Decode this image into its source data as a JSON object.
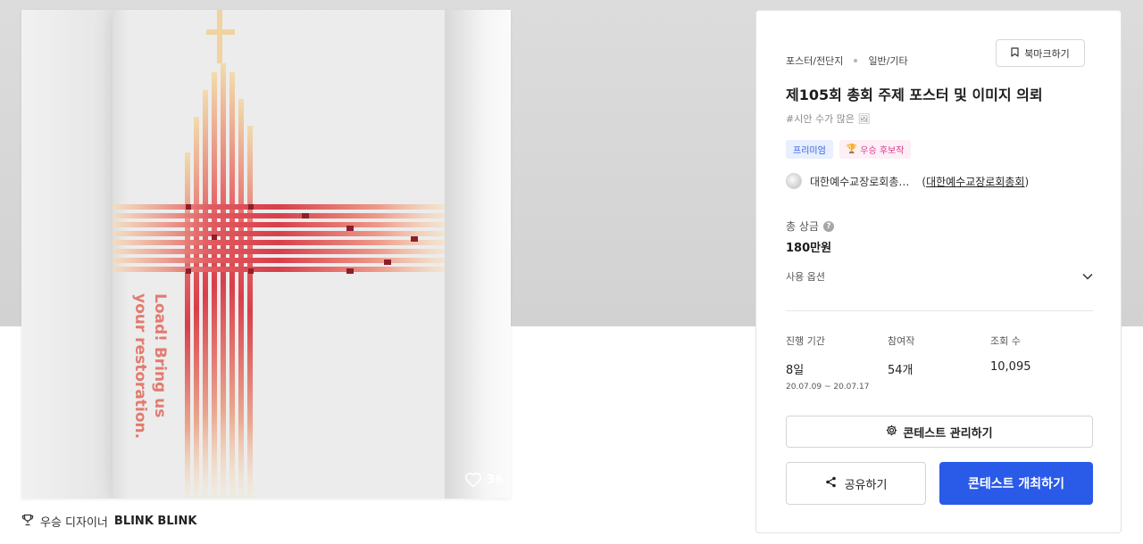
{
  "poster": {
    "slogan": "Load! Bring us\nyour restoration.",
    "like_count": "36"
  },
  "designer": {
    "prefix": "우승 디자이너",
    "name": "BLINK BLINK"
  },
  "panel": {
    "category": "포스터/전단지",
    "subcategory": "일반/기타",
    "bookmark_label": "북마크하기",
    "title": "제105회 총회 주제 포스터 및 이미지 의뢰",
    "hashtag": "#시안 수가 많은 🖼",
    "badges": [
      "프리미엄",
      "우승 후보작"
    ],
    "org_name": "대한예수교장로회총…",
    "org_link": "대한예수교장로회총회",
    "prize_label": "총 상금",
    "prize_value": "180만원",
    "usage_label": "사용 옵션",
    "stats": {
      "period_label": "진행 기간",
      "period_value": "8일",
      "period_range": "20.07.09 ~ 20.07.17",
      "entries_label": "참여작",
      "entries_value": "54개",
      "views_label": "조회 수",
      "views_value": "10,095"
    },
    "manage_label": "콘테스트 관리하기",
    "share_label": "공유하기",
    "host_label": "콘테스트 개최하기"
  },
  "colors": {
    "primary": "#2a5ae8",
    "premium_bg": "#e8efff",
    "premium_text": "#2f5fe0",
    "candidate_bg": "#fdeff6",
    "candidate_text": "#de3a8e",
    "cross_red": "#d8454f"
  }
}
